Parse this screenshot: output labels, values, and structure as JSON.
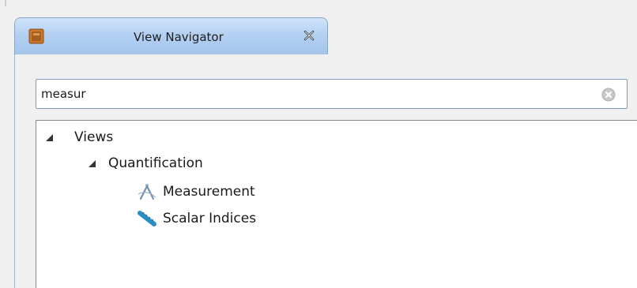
{
  "tab": {
    "title": "View Navigator",
    "icon": "panel-icon",
    "close_icon": "close-icon"
  },
  "search": {
    "value": "measur",
    "clear_icon": "clear-search-icon"
  },
  "tree": {
    "items": [
      {
        "label": "Views",
        "expanded": true,
        "icon": "expanded-arrow-icon"
      },
      {
        "label": "Quantification",
        "expanded": true,
        "icon": "expanded-arrow-icon"
      },
      {
        "label": "Measurement",
        "icon": "measurement-compass-icon"
      },
      {
        "label": "Scalar Indices",
        "icon": "scalar-indices-ruler-icon"
      }
    ]
  },
  "colors": {
    "tab_gradient_top": "#cfe4fb",
    "tab_gradient_bottom": "#a4c4ec",
    "ruler_blue": "#2a8fc4",
    "search_border": "#7a9cc3"
  }
}
